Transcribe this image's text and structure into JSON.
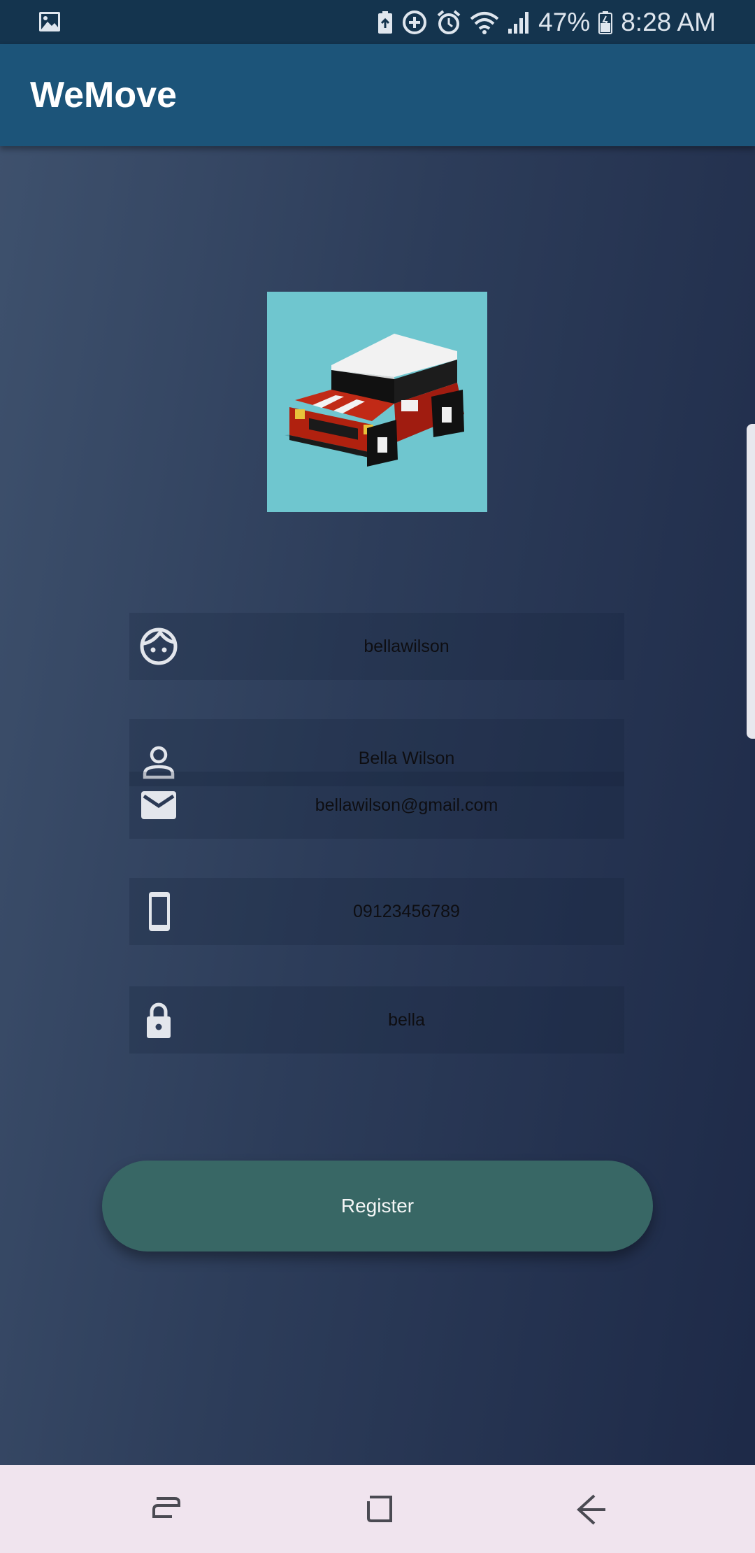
{
  "status_bar": {
    "battery_percent": "47%",
    "time": "8:28 AM",
    "icons": [
      "image-icon",
      "battery-saver-icon",
      "data-saver-icon",
      "alarm-icon",
      "wifi-icon",
      "signal-icon",
      "battery-icon"
    ]
  },
  "app_bar": {
    "title": "WeMove"
  },
  "form": {
    "username": "bellawilson",
    "full_name": "Bella Wilson",
    "email": "bellawilson@gmail.com",
    "phone": "09123456789",
    "password": "bella"
  },
  "register_label": "Register",
  "nav_bar": {
    "icons": [
      "recents-icon",
      "home-icon",
      "back-icon"
    ]
  },
  "colors": {
    "app_bar": "#1c5479",
    "status_bar": "#14344e",
    "button": "#386765",
    "logo_bg": "#6fc6cf",
    "nav_bar": "#f0e4ee"
  }
}
